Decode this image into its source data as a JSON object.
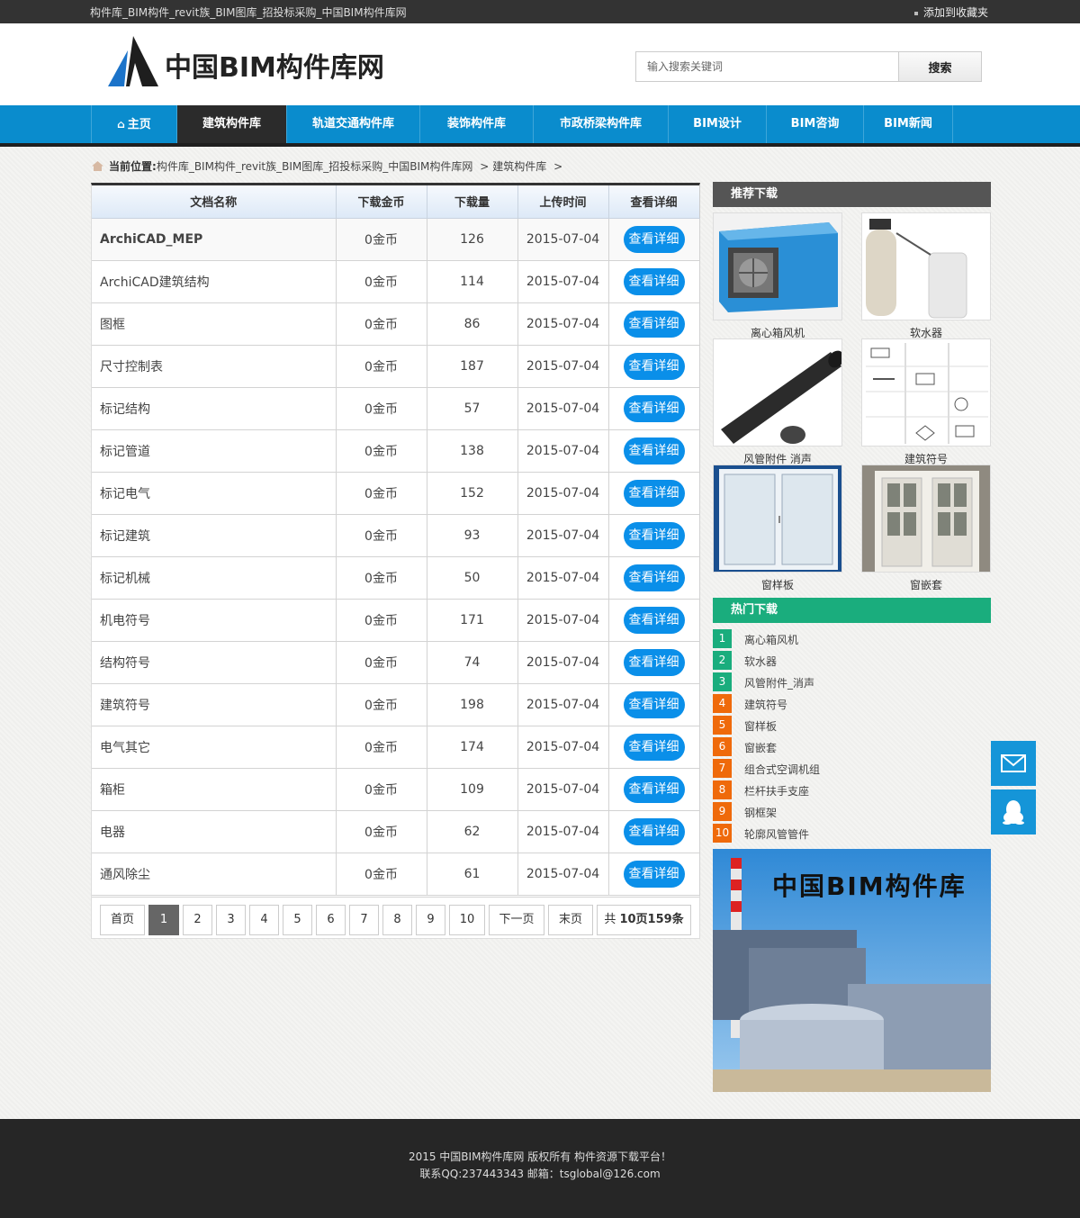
{
  "topbar": {
    "site_title": "构件库_BIM构件_revit族_BIM图库_招投标采购_中国BIM构件库网",
    "favorite": "添加到收藏夹"
  },
  "header": {
    "logo_text": "中国BIM构件库网",
    "search_placeholder": "输入搜索关键词",
    "search_button": "搜索"
  },
  "nav": {
    "items": [
      {
        "label": "主页",
        "active": false
      },
      {
        "label": "建筑构件库",
        "active": true
      },
      {
        "label": "轨道交通构件库",
        "active": false
      },
      {
        "label": "装饰构件库",
        "active": false
      },
      {
        "label": "市政桥梁构件库",
        "active": false
      },
      {
        "label": "BIM设计",
        "active": false
      },
      {
        "label": "BIM咨询",
        "active": false
      },
      {
        "label": "BIM新闻",
        "active": false
      }
    ]
  },
  "breadcrumb": {
    "prefix": "当前位置:",
    "home": "构件库_BIM构件_revit族_BIM图库_招投标采购_中国BIM构件库网",
    "sep": ">",
    "current": "建筑构件库"
  },
  "table": {
    "headers": [
      "文档名称",
      "下载金币",
      "下载量",
      "上传时间",
      "查看详细"
    ],
    "button_label": "查看详细",
    "rows": [
      {
        "name": "ArchiCAD_MEP",
        "coins": "0金币",
        "downloads": "126",
        "date": "2015-07-04"
      },
      {
        "name": "ArchiCAD建筑结构",
        "coins": "0金币",
        "downloads": "114",
        "date": "2015-07-04"
      },
      {
        "name": "图框",
        "coins": "0金币",
        "downloads": "86",
        "date": "2015-07-04"
      },
      {
        "name": "尺寸控制表",
        "coins": "0金币",
        "downloads": "187",
        "date": "2015-07-04"
      },
      {
        "name": "标记结构",
        "coins": "0金币",
        "downloads": "57",
        "date": "2015-07-04"
      },
      {
        "name": "标记管道",
        "coins": "0金币",
        "downloads": "138",
        "date": "2015-07-04"
      },
      {
        "name": "标记电气",
        "coins": "0金币",
        "downloads": "152",
        "date": "2015-07-04"
      },
      {
        "name": "标记建筑",
        "coins": "0金币",
        "downloads": "93",
        "date": "2015-07-04"
      },
      {
        "name": "标记机械",
        "coins": "0金币",
        "downloads": "50",
        "date": "2015-07-04"
      },
      {
        "name": "机电符号",
        "coins": "0金币",
        "downloads": "171",
        "date": "2015-07-04"
      },
      {
        "name": "结构符号",
        "coins": "0金币",
        "downloads": "74",
        "date": "2015-07-04"
      },
      {
        "name": "建筑符号",
        "coins": "0金币",
        "downloads": "198",
        "date": "2015-07-04"
      },
      {
        "name": "电气其它",
        "coins": "0金币",
        "downloads": "174",
        "date": "2015-07-04"
      },
      {
        "name": "箱柜",
        "coins": "0金币",
        "downloads": "109",
        "date": "2015-07-04"
      },
      {
        "name": "电器",
        "coins": "0金币",
        "downloads": "62",
        "date": "2015-07-04"
      },
      {
        "name": "通风除尘",
        "coins": "0金币",
        "downloads": "61",
        "date": "2015-07-04"
      }
    ]
  },
  "pager": {
    "first": "首页",
    "pages": [
      "1",
      "2",
      "3",
      "4",
      "5",
      "6",
      "7",
      "8",
      "9",
      "10"
    ],
    "current": "1",
    "next": "下一页",
    "last": "末页",
    "total_prefix": "共 ",
    "total_pages": "10页",
    "total_count": "159条"
  },
  "side": {
    "recommend_title": "推荐下载",
    "recommend": [
      "离心箱风机",
      "软水器",
      "风管附件 消声",
      "建筑符号",
      "窗样板",
      "窗嵌套"
    ],
    "hot_title": "热门下载",
    "hot": [
      "离心箱风机",
      "软水器",
      "风管附件_消声",
      "建筑符号",
      "窗样板",
      "窗嵌套",
      "组合式空调机组",
      "栏杆扶手支座",
      "钢框架",
      "轮廓风管管件"
    ],
    "hot_numbers": [
      "1",
      "2",
      "3",
      "4",
      "5",
      "6",
      "7",
      "8",
      "9",
      "10"
    ],
    "banner_text": "中国BIM构件库"
  },
  "footer": {
    "line1": "2015 中国BIM构件库网 版权所有  构件资源下载平台！",
    "line2": "联系QQ:237443343  邮箱：tsglobal@126.com"
  },
  "colors": {
    "nav_blue": "#0a8ccd",
    "btn_blue": "#0a8fe9",
    "green": "#1aad7d",
    "orange": "#ef6a0b"
  }
}
